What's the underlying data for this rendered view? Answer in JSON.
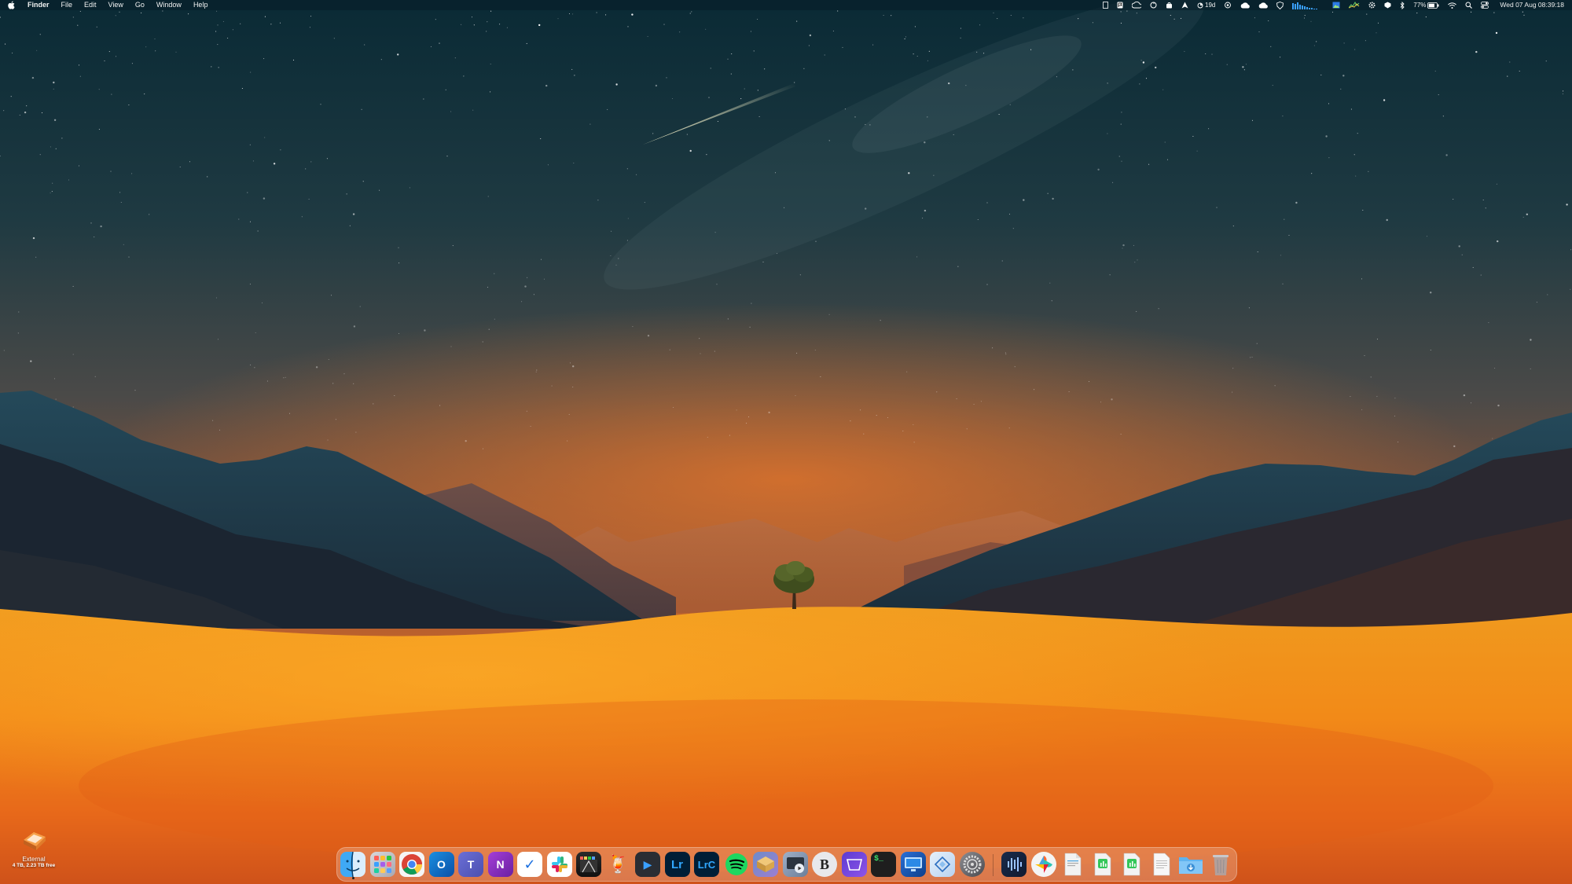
{
  "menubar": {
    "apple_icon": "apple-icon",
    "app_name": "Finder",
    "items": [
      "File",
      "Edit",
      "View",
      "Go",
      "Window",
      "Help"
    ],
    "status_texts": {
      "days": "19d",
      "battery_percent": "77%"
    },
    "clock": "Wed 07 Aug  08:39:18",
    "status_icons": [
      "doc-icon",
      "flag-icon",
      "cloud-sync-icon",
      "sync-icon",
      "bag-icon",
      "send-icon",
      "pie-icon",
      "weather-cloud-icon",
      "cloud-icon",
      "shield-icon",
      "network-graph-icon",
      "image-icon",
      "chart-icon",
      "gear-icon",
      "bell-icon",
      "bluetooth-icon",
      "wifi-icon",
      "battery-icon",
      "search-icon",
      "control-center-icon"
    ]
  },
  "desktop": {
    "drive": {
      "name": "External",
      "detail": "4 TB, 2.23 TB free",
      "icon": "external-drive-icon"
    }
  },
  "dock": {
    "apps": [
      {
        "name": "Finder",
        "icon": "finder-icon",
        "running": true
      },
      {
        "name": "Launchpad",
        "icon": "launchpad-icon"
      },
      {
        "name": "Google Chrome",
        "icon": "chrome-icon"
      },
      {
        "name": "Microsoft Outlook",
        "icon": "outlook-icon",
        "glyph": "O"
      },
      {
        "name": "Microsoft Teams",
        "icon": "teams-icon",
        "glyph": "T"
      },
      {
        "name": "Microsoft OneNote",
        "icon": "onenote-icon",
        "glyph": "N"
      },
      {
        "name": "Microsoft To Do",
        "icon": "todo-icon",
        "glyph": "✓"
      },
      {
        "name": "Slack",
        "icon": "slack-icon"
      },
      {
        "name": "Final Cut Pro",
        "icon": "final-cut-icon"
      },
      {
        "name": "Cocktail",
        "icon": "cocktail-icon",
        "glyph": "🍹"
      },
      {
        "name": "Infuse",
        "icon": "infuse-icon",
        "glyph": "▶"
      },
      {
        "name": "Lightroom",
        "icon": "lightroom-icon",
        "glyph": "Lr"
      },
      {
        "name": "Lightroom Classic",
        "icon": "lightroom-classic-icon",
        "glyph": "LrC"
      },
      {
        "name": "Spotify",
        "icon": "spotify-icon"
      },
      {
        "name": "Archive Utility",
        "icon": "archive-icon"
      },
      {
        "name": "Screen Recorder",
        "icon": "screen-recorder-icon"
      },
      {
        "name": "BBEdit",
        "icon": "bbedit-icon",
        "glyph": "B"
      },
      {
        "name": "Notchmeister",
        "icon": "notch-icon"
      },
      {
        "name": "Terminal",
        "icon": "terminal-icon",
        "glyph": "$_"
      },
      {
        "name": "Screen Sharing",
        "icon": "screen-sharing-icon"
      },
      {
        "name": "Xcode Instruments",
        "icon": "blueprint-icon"
      },
      {
        "name": "System Settings",
        "icon": "settings-icon"
      },
      {
        "name": "Podcast Audio",
        "icon": "waveform-icon"
      },
      {
        "name": "Pinwheel",
        "icon": "pinwheel-icon"
      },
      {
        "name": "Document",
        "icon": "document-icon"
      },
      {
        "name": "Numbers Sheet",
        "icon": "numbers-sheet-icon"
      },
      {
        "name": "Numbers Sheet 2",
        "icon": "numbers-sheet-2-icon"
      },
      {
        "name": "Text File",
        "icon": "text-file-icon"
      },
      {
        "name": "Downloads",
        "icon": "downloads-folder-icon"
      },
      {
        "name": "Trash",
        "icon": "trash-icon"
      }
    ]
  },
  "colors": {
    "sky_top": "#0b2a36",
    "sky_bottom": "#c2602a",
    "dune": "#f0961c",
    "mountain_dark": "#1e3340"
  }
}
